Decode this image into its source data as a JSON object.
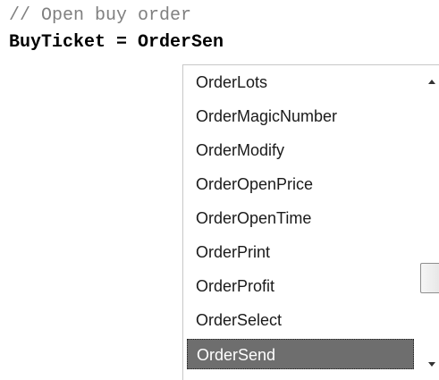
{
  "editor": {
    "comment_line": "// Open buy order",
    "code_line": "BuyTicket = OrderSen"
  },
  "autocomplete": {
    "items": [
      {
        "label": "OrderLots",
        "selected": false
      },
      {
        "label": "OrderMagicNumber",
        "selected": false
      },
      {
        "label": "OrderModify",
        "selected": false
      },
      {
        "label": "OrderOpenPrice",
        "selected": false
      },
      {
        "label": "OrderOpenTime",
        "selected": false
      },
      {
        "label": "OrderPrint",
        "selected": false
      },
      {
        "label": "OrderProfit",
        "selected": false
      },
      {
        "label": "OrderSelect",
        "selected": false
      },
      {
        "label": "OrderSend",
        "selected": true
      }
    ],
    "selected_label": "OrderSend",
    "scroll_position_fraction": 0.72
  },
  "icons": {
    "scroll_up": "chevron-up-icon",
    "scroll_down": "chevron-down-icon"
  },
  "colors": {
    "comment": "#808080",
    "selection_bg": "#6e6e6e",
    "selection_text": "#ffffff"
  }
}
